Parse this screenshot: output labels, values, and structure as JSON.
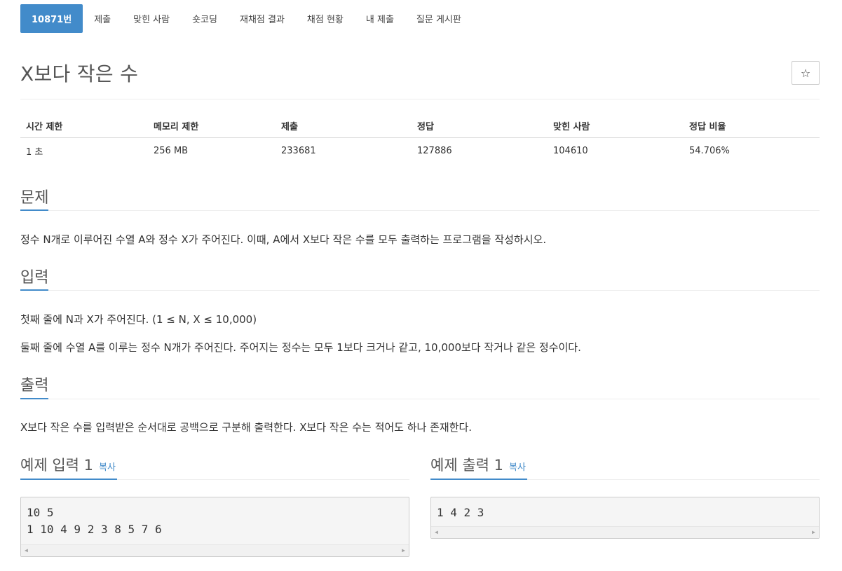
{
  "nav": {
    "items": [
      {
        "label": "10871번",
        "active": true
      },
      {
        "label": "제출"
      },
      {
        "label": "맞힌 사람"
      },
      {
        "label": "숏코딩"
      },
      {
        "label": "재채점 결과"
      },
      {
        "label": "채점 현황"
      },
      {
        "label": "내 제출"
      },
      {
        "label": "질문 게시판"
      }
    ]
  },
  "problem": {
    "title": "X보다 작은 수",
    "star_icon": "☆"
  },
  "info": {
    "headers": [
      "시간 제한",
      "메모리 제한",
      "제출",
      "정답",
      "맞힌 사람",
      "정답 비율"
    ],
    "values": [
      "1 초",
      "256 MB",
      "233681",
      "127886",
      "104610",
      "54.706%"
    ]
  },
  "sections": {
    "problem": {
      "heading": "문제",
      "text": "정수 N개로 이루어진 수열 A와 정수 X가 주어진다. 이때, A에서 X보다 작은 수를 모두 출력하는 프로그램을 작성하시오."
    },
    "input": {
      "heading": "입력",
      "line1": "첫째 줄에 N과 X가 주어진다. (1 ≤ N, X ≤ 10,000)",
      "line2": "둘째 줄에 수열 A를 이루는 정수 N개가 주어진다. 주어지는 정수는 모두 1보다 크거나 같고, 10,000보다 작거나 같은 정수이다."
    },
    "output": {
      "heading": "출력",
      "text": "X보다 작은 수를 입력받은 순서대로 공백으로 구분해 출력한다. X보다 작은 수는 적어도 하나 존재한다."
    }
  },
  "samples": {
    "input": {
      "heading": "예제 입력 1",
      "copy_label": "복사",
      "content": "10 5\n1 10 4 9 2 3 8 5 7 6"
    },
    "output": {
      "heading": "예제 출력 1",
      "copy_label": "복사",
      "content": "1 4 2 3"
    }
  },
  "colors": {
    "accent": "#428bca",
    "text": "#333333",
    "heading": "#555555"
  }
}
